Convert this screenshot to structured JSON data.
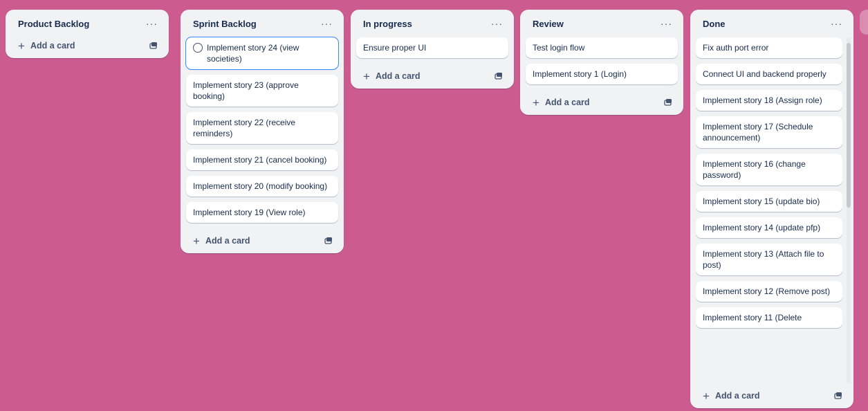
{
  "lists": [
    {
      "title": "Product Backlog",
      "cards": [],
      "add_card_label": "Add a card"
    },
    {
      "title": "Sprint Backlog",
      "cards": [
        "Implement story 24 (view societies)",
        "Implement story 23 (approve booking)",
        "Implement story 22 (receive reminders)",
        "Implement story 21 (cancel booking)",
        "Implement story 20 (modify booking)",
        "Implement story 19 (View role)"
      ],
      "add_card_label": "Add a card"
    },
    {
      "title": "In progress",
      "cards": [
        "Ensure proper UI"
      ],
      "add_card_label": "Add a card"
    },
    {
      "title": "Review",
      "cards": [
        "Test login flow",
        "Implement story 1 (Login)"
      ],
      "add_card_label": "Add a card"
    },
    {
      "title": "Done",
      "cards": [
        "Fix auth port error",
        "Connect UI and backend properly",
        "Implement story 18 (Assign role)",
        "Implement story 17 (Schedule announcement)",
        "Implement story 16 (change password)",
        "Implement story 15 (update bio)",
        "Implement story 14 (update pfp)",
        "Implement story 13 (Attach file to post)",
        "Implement story 12 (Remove post)",
        "Implement story 11 (Delete"
      ],
      "add_card_label": "Add a card"
    }
  ],
  "list_menu_glyph": "···",
  "add_glyph": "+",
  "icons": {
    "list_menu": "ellipsis-icon",
    "add": "plus-icon",
    "template": "card-template-icon",
    "card_complete": "circle-icon"
  },
  "colors": {
    "board_background": "#cc5c90",
    "list_background": "#f1f2f4",
    "selected_outline": "#388bff"
  }
}
